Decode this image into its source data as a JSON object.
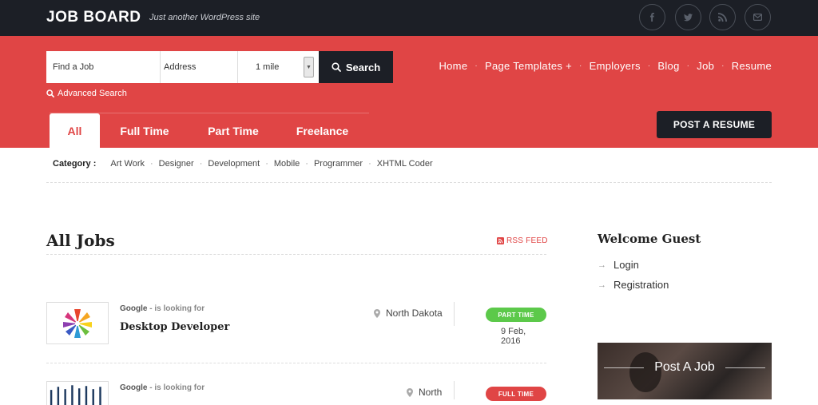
{
  "header": {
    "brand": "JOB BOARD",
    "tagline": "Just another WordPress site",
    "social": [
      "facebook-icon",
      "twitter-icon",
      "rss-icon",
      "mail-icon"
    ]
  },
  "search": {
    "job_placeholder": "Find a Job",
    "address_placeholder": "Address",
    "radius_value": "1 mile",
    "button_label": "Search",
    "advanced_label": "Advanced Search"
  },
  "nav": {
    "items": [
      "Home",
      "Page Templates +",
      "Employers",
      "Blog",
      "Job",
      "Resume"
    ]
  },
  "tabs": [
    "All",
    "Full Time",
    "Part Time",
    "Freelance"
  ],
  "post_resume_label": "POST A RESUME",
  "categories": {
    "label": "Category :",
    "items": [
      "Art Work",
      "Designer",
      "Development",
      "Mobile",
      "Programmer",
      "XHTML Coder"
    ]
  },
  "main": {
    "title": "All Jobs",
    "rss_label": "RSS FEED"
  },
  "jobs": [
    {
      "company": "Google",
      "looking": "- is looking for",
      "title": "Desktop Developer",
      "location": "North Dakota",
      "type": "PART TIME",
      "type_color": "#5cc94a",
      "date": "9 Feb, 2016"
    },
    {
      "company": "Google",
      "looking": "- is looking for",
      "title": "",
      "location": "North",
      "type": "FULL TIME",
      "type_color": "#e04545",
      "date": ""
    }
  ],
  "sidebar": {
    "welcome": "Welcome Guest",
    "login": "Login",
    "registration": "Registration",
    "post_job": "Post A Job"
  },
  "colors": {
    "accent": "#e04545",
    "dark": "#1c1f26"
  }
}
